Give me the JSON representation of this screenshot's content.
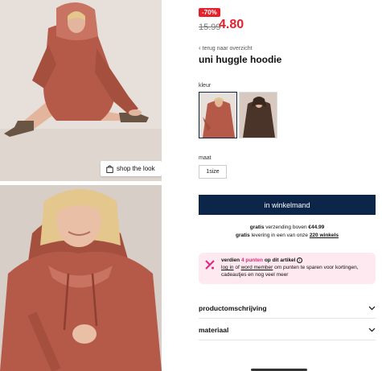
{
  "gallery": {
    "shop_the_look": "shop the look",
    "colors": {
      "hoodie": "#b55a48",
      "hoodie_dark": "#8f3f31",
      "hoodie_light": "#c97462",
      "skin": "#e2b59c",
      "hair": "#e3c78c",
      "socks": "#6a5544",
      "backdrop": "#e7dfd9"
    }
  },
  "product": {
    "discount_badge": "-70%",
    "old_price": "15.99",
    "new_price": "4.80",
    "back_link": "terug naar overzicht",
    "title": "uni huggle hoodie"
  },
  "options": {
    "color_label": "kleur",
    "colors": [
      {
        "name": "rust",
        "hex": "#b55a48",
        "selected": true
      },
      {
        "name": "dark brown",
        "hex": "#4a3328",
        "selected": false
      }
    ],
    "size_label": "maat",
    "sizes": [
      "1size"
    ]
  },
  "cart": {
    "button_label": "in winkelmand"
  },
  "shipping": {
    "line1_bold": "gratis",
    "line1_text": " verzending boven ",
    "line1_amount": "€44.99",
    "line2_bold": "gratis",
    "line2_text": " levering in een van onze ",
    "line2_link": "220 winkels"
  },
  "loyalty": {
    "pre": "verdien ",
    "points": "4 punten",
    "post": " op dit artikel",
    "info": "i",
    "login": "log in",
    "of": " of ",
    "member": "word member",
    "rest": " om punten te sparen voor kortingen, cadeautjes en nog veel meer"
  },
  "accordion": [
    {
      "label": "productomschrijving"
    },
    {
      "label": "materiaal"
    }
  ],
  "accent_colors": {
    "navy": "#0c2649",
    "sale_red": "#e4202a",
    "loyalty_pink": "#fde9ef",
    "points_magenta": "#e0267a"
  }
}
